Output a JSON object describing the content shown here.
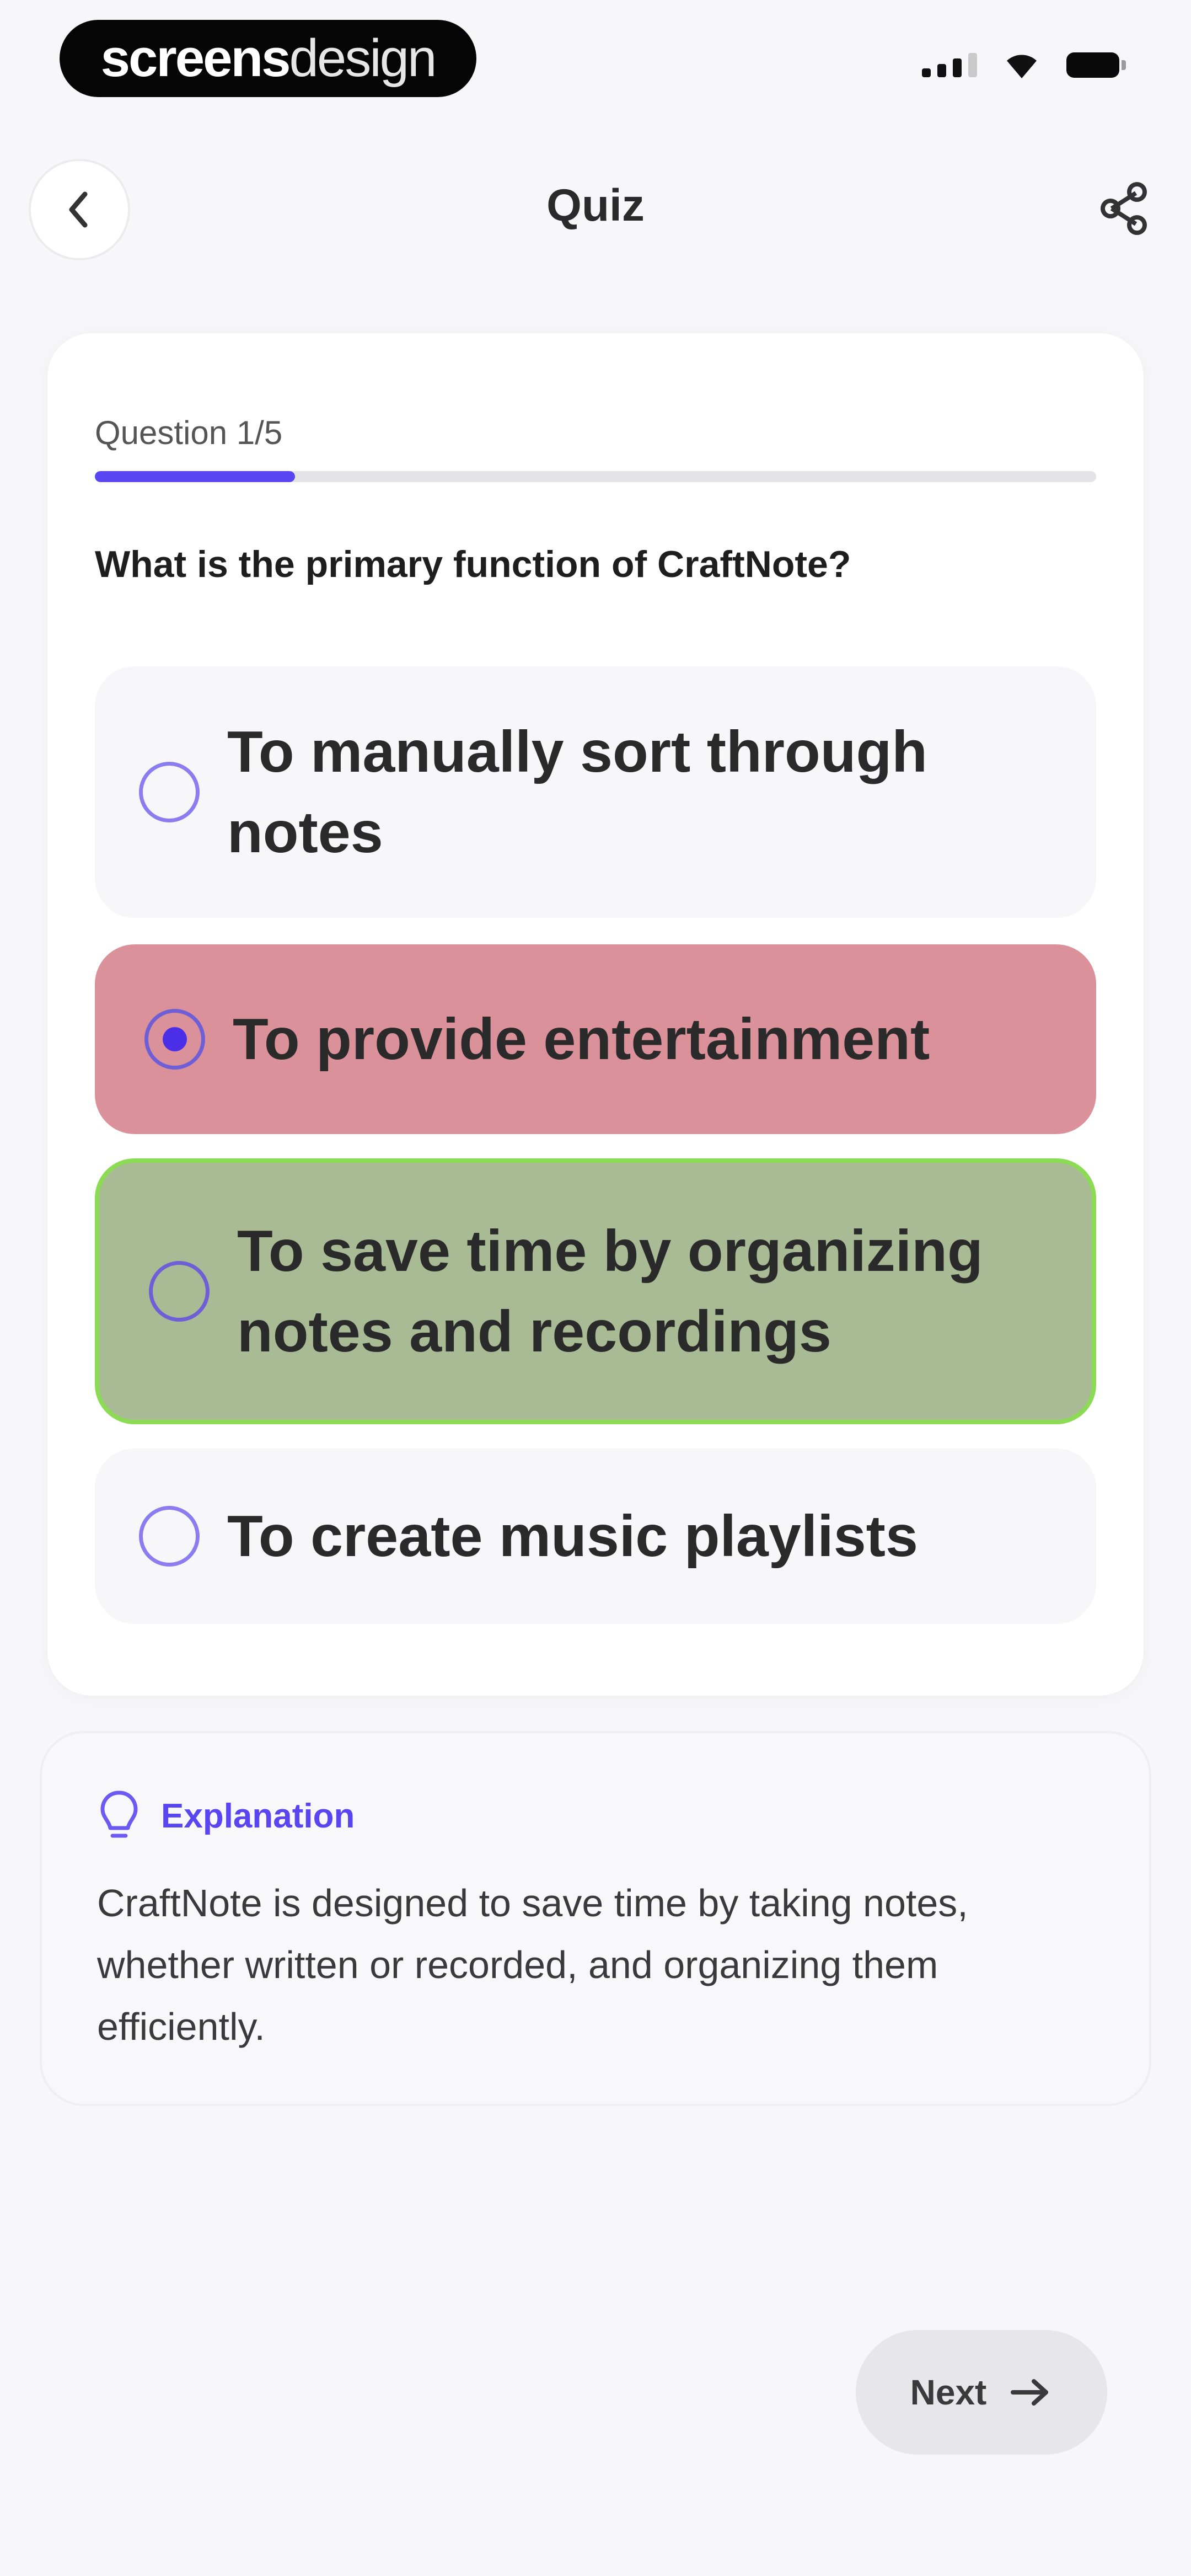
{
  "status_bar": {
    "brand_bold": "screens",
    "brand_light": "design"
  },
  "nav": {
    "title": "Quiz",
    "back_icon": "chevron-left-icon",
    "share_icon": "share-icon"
  },
  "quiz": {
    "counter": "Question 1/5",
    "progress": {
      "current": 1,
      "total": 5,
      "fraction": 0.2
    },
    "question": "What is the primary function of CraftNote?",
    "options": [
      {
        "label": "To manually sort through notes",
        "state": "unselected"
      },
      {
        "label": "To provide entertainment",
        "state": "selected-wrong"
      },
      {
        "label": "To save time by organizing notes and recordings",
        "state": "correct"
      },
      {
        "label": "To create music playlists",
        "state": "unselected"
      }
    ]
  },
  "explanation": {
    "title": "Explanation",
    "icon": "lightbulb-icon",
    "body": "CraftNote is designed to save time by taking notes, whether written or recorded, and organizing them efficiently."
  },
  "footer": {
    "next_label": "Next",
    "next_icon": "arrow-right-icon"
  },
  "colors": {
    "accent": "#5a46f0",
    "wrong": "#db9199",
    "correct": "#a8bb94",
    "correct_border": "#8bdb54",
    "background": "#f7f7f9"
  }
}
